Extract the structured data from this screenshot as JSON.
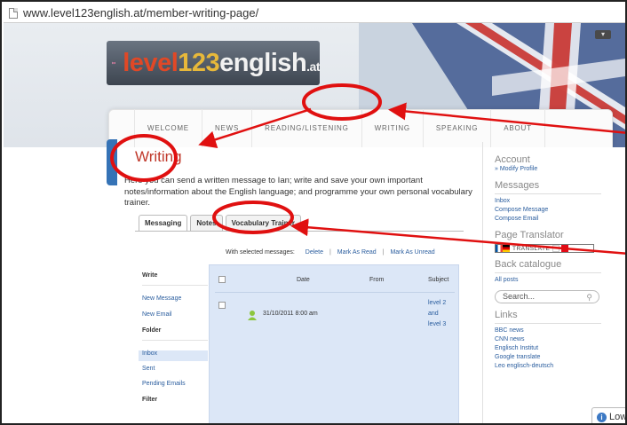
{
  "browser": {
    "url": "www.level123english.at/member-writing-page/"
  },
  "logo": {
    "part1": "level",
    "part2": "123",
    "part3": "english",
    "suffix": ".at"
  },
  "nav": [
    "Welcome",
    "News",
    "Reading/Listening",
    "Writing",
    "Speaking",
    "About"
  ],
  "page": {
    "title": "Writing",
    "intro": "Here you can send a written message to Ian; write and save your own important notes/information about the English language; and programme your own personal vocabulary trainer."
  },
  "tabs": [
    "Messaging",
    "Notes",
    "Vocabulary Trainer"
  ],
  "selected_bar": {
    "label": "With selected messages:",
    "actions": [
      "Delete",
      "Mark As Read",
      "Mark As Unread"
    ]
  },
  "sidebar_menu": {
    "write_heading": "Write",
    "write_items": [
      "New Message",
      "New Email"
    ],
    "folder_heading": "Folder",
    "folder_items": [
      "Inbox",
      "Sent",
      "Pending Emails"
    ],
    "filter_heading": "Filter"
  },
  "message_table": {
    "columns": [
      "Date",
      "From",
      "Subject"
    ],
    "rows": [
      {
        "date": "31/10/2011 8:00 am",
        "from": "",
        "subject": "level 2 and level 3"
      }
    ]
  },
  "right_sidebar": {
    "account_heading": "Account",
    "account_link": "» Modify Profile",
    "messages_heading": "Messages",
    "messages_links": [
      "Inbox",
      "Compose Message",
      "Compose Email"
    ],
    "translator_heading": "Page Translator",
    "translate_label": "TRANSLATE",
    "catalogue_heading": "Back catalogue",
    "catalogue_link": "All posts",
    "search_placeholder": "Search...",
    "links_heading": "Links",
    "links": [
      "BBC news",
      "CNN news",
      "Englisch Institut",
      "Google translate",
      "Leo englisch-deutsch"
    ]
  },
  "notice": {
    "label": "Low"
  },
  "colors": {
    "accent_red": "#c0392b",
    "link_blue": "#2a5d9e",
    "panel_blue": "#dce7f7",
    "annotation_red": "#e01010"
  }
}
